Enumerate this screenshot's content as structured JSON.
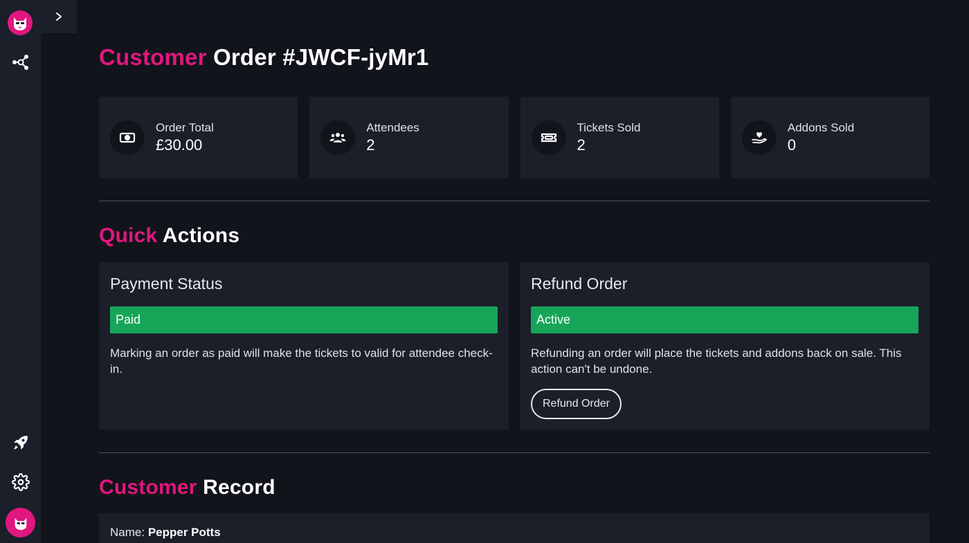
{
  "page": {
    "title_accent": "Customer",
    "title_rest": "Order #JWCF-jyMr1"
  },
  "stats": [
    {
      "label": "Order Total",
      "value": "£30.00",
      "icon": "money-icon"
    },
    {
      "label": "Attendees",
      "value": "2",
      "icon": "users-icon"
    },
    {
      "label": "Tickets Sold",
      "value": "2",
      "icon": "ticket-icon"
    },
    {
      "label": "Addons Sold",
      "value": "0",
      "icon": "heart-hand-icon"
    }
  ],
  "quick_actions": {
    "heading_accent": "Quick",
    "heading_rest": "Actions",
    "payment": {
      "title": "Payment Status",
      "status": "Paid",
      "description": "Marking an order as paid will make the tickets to valid for attendee check-in."
    },
    "refund": {
      "title": "Refund Order",
      "status": "Active",
      "description": "Refunding an order will place the tickets and addons back on sale. This action can't be undone.",
      "button_label": "Refund Order"
    }
  },
  "customer_record": {
    "heading_accent": "Customer",
    "heading_rest": "Record",
    "name_label": "Name:",
    "name_value": "Pepper Potts"
  },
  "colors": {
    "accent": "#e0177e",
    "success": "#17a55a",
    "background": "#12141b",
    "card": "#1b1f2a"
  }
}
